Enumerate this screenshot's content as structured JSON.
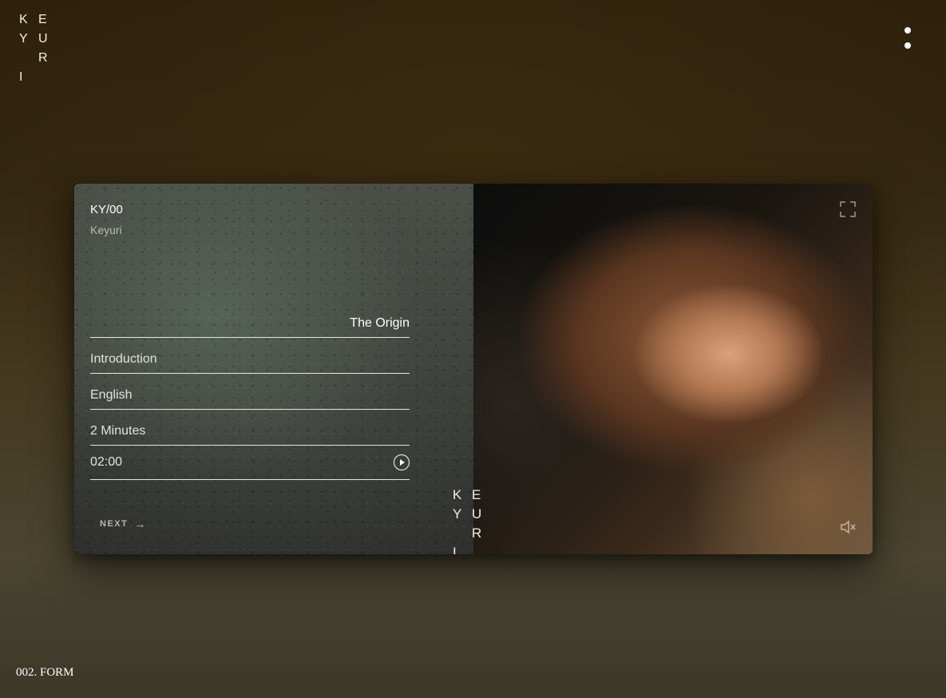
{
  "header": {
    "logo_letters": [
      "K",
      "E",
      "Y",
      "U",
      "",
      "R",
      "I"
    ],
    "menu_icon": "vertical-dots-icon"
  },
  "card": {
    "code": "KY/00",
    "brand": "Keyuri",
    "title": "The Origin",
    "fields": {
      "section": "Introduction",
      "language": "English",
      "duration": "2 Minutes",
      "timer": "02:00"
    },
    "next_label": "NEXT",
    "next_icon": "arrow-right-icon",
    "play_icon": "play-circle-icon",
    "fullscreen_icon": "expand-icon",
    "mute_icon": "speaker-muted-icon",
    "logo_letters": [
      "K",
      "E",
      "Y",
      "U",
      "",
      "R",
      "I"
    ]
  },
  "footer": {
    "label": "002. FORM"
  }
}
